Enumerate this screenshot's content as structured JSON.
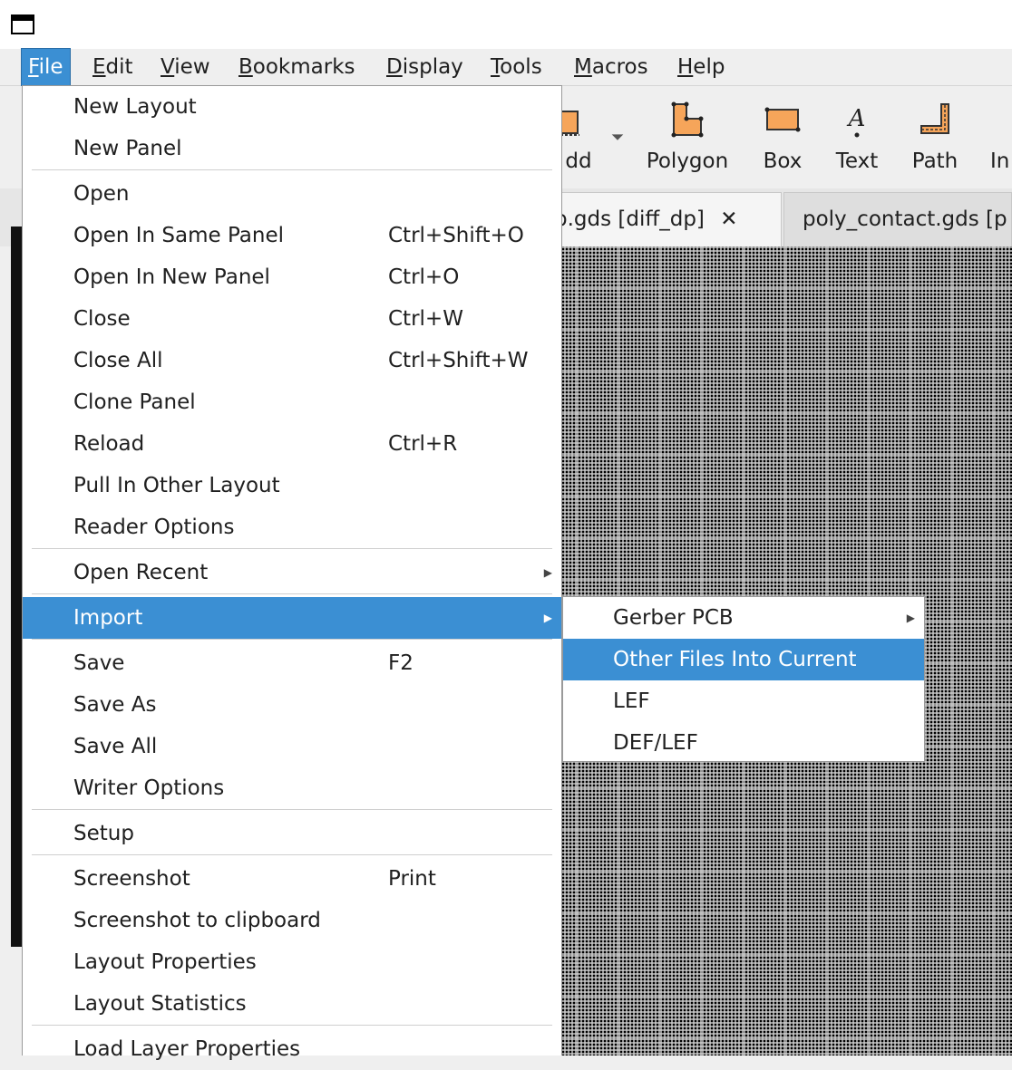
{
  "menubar": {
    "items": [
      {
        "mn": "F",
        "rest": "ile"
      },
      {
        "mn": "E",
        "rest": "dit"
      },
      {
        "mn": "V",
        "rest": "iew"
      },
      {
        "mn": "B",
        "rest": "ookmarks"
      },
      {
        "mn": "D",
        "rest": "isplay"
      },
      {
        "mn": "T",
        "rest": "ools"
      },
      {
        "mn": "M",
        "rest": "acros"
      },
      {
        "mn": "H",
        "rest": "elp"
      }
    ]
  },
  "toolbar": {
    "add_label": "dd",
    "polygon_label": "Polygon",
    "box_label": "Box",
    "text_label": "Text",
    "path_label": "Path",
    "more_label": "In"
  },
  "tabs": {
    "active": "p.gds [diff_dp]",
    "close_glyph": "✕",
    "second": "poly_contact.gds [p"
  },
  "file_menu": {
    "new_layout": "New Layout",
    "new_panel": "New Panel",
    "open": "Open",
    "open_same": "Open In Same Panel",
    "open_same_sc": "Ctrl+Shift+O",
    "open_new": "Open In New Panel",
    "open_new_sc": "Ctrl+O",
    "close": "Close",
    "close_sc": "Ctrl+W",
    "close_all": "Close All",
    "close_all_sc": "Ctrl+Shift+W",
    "clone_panel": "Clone Panel",
    "reload": "Reload",
    "reload_sc": "Ctrl+R",
    "pull_in": "Pull In Other Layout",
    "reader_options": "Reader Options",
    "open_recent": "Open Recent",
    "import": "Import",
    "save": "Save",
    "save_sc": "F2",
    "save_as": "Save As",
    "save_all": "Save All",
    "writer_options": "Writer Options",
    "setup": "Setup",
    "screenshot": "Screenshot",
    "screenshot_sc": "Print",
    "screenshot_clip": "Screenshot to clipboard",
    "layout_props": "Layout Properties",
    "layout_stats": "Layout Statistics",
    "load_layer_props": "Load Layer Properties"
  },
  "import_menu": {
    "gerber": "Gerber PCB",
    "other_files": "Other Files Into Current",
    "lef": "LEF",
    "deflef": "DEF/LEF"
  },
  "colors": {
    "highlight": "#3b8fd3",
    "canvas": "#000000"
  }
}
